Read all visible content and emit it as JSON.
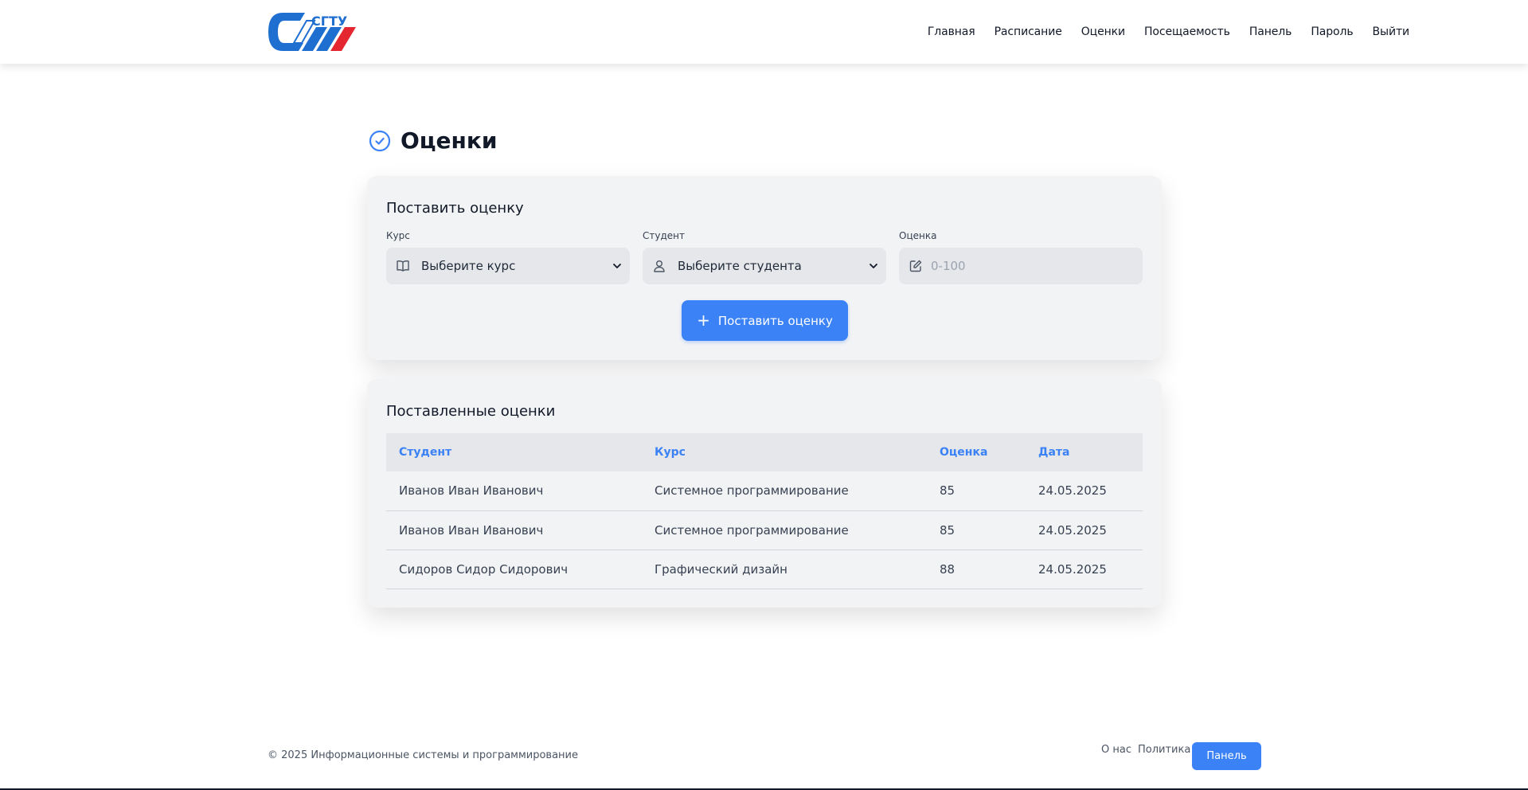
{
  "header": {
    "logo_alt": "СГТУ",
    "nav": [
      "Главная",
      "Расписание",
      "Оценки",
      "Посещаемость",
      "Панель",
      "Пароль",
      "Выйти"
    ]
  },
  "page": {
    "title": "Оценки",
    "title_icon": "check-circle-icon"
  },
  "form": {
    "title": "Поставить оценку",
    "course_label": "Курс",
    "course_value": "Выберите курс",
    "student_label": "Студент",
    "student_value": "Выберите студента",
    "grade_label": "Оценка",
    "grade_placeholder": "0-100",
    "submit_label": "Поставить оценку"
  },
  "grades": {
    "title": "Поставленные оценки",
    "columns": [
      "Студент",
      "Курс",
      "Оценка",
      "Дата"
    ],
    "rows": [
      [
        "Иванов Иван Иванович",
        "Системное программирование",
        "85",
        "24.05.2025"
      ],
      [
        "Иванов Иван Иванович",
        "Системное программирование",
        "85",
        "24.05.2025"
      ],
      [
        "Сидоров Сидор Сидорович",
        "Графический дизайн",
        "88",
        "24.05.2025"
      ]
    ]
  },
  "footer": {
    "copyright": "© 2025 Информационные системы и программирование",
    "links": [
      "О нас",
      "Политика"
    ],
    "button": "Панель"
  },
  "colors": {
    "accent": "#3b82f6",
    "card_bg": "#f2f3f5",
    "logo_blue": "#1f6fd1",
    "logo_red": "#e3262f"
  }
}
